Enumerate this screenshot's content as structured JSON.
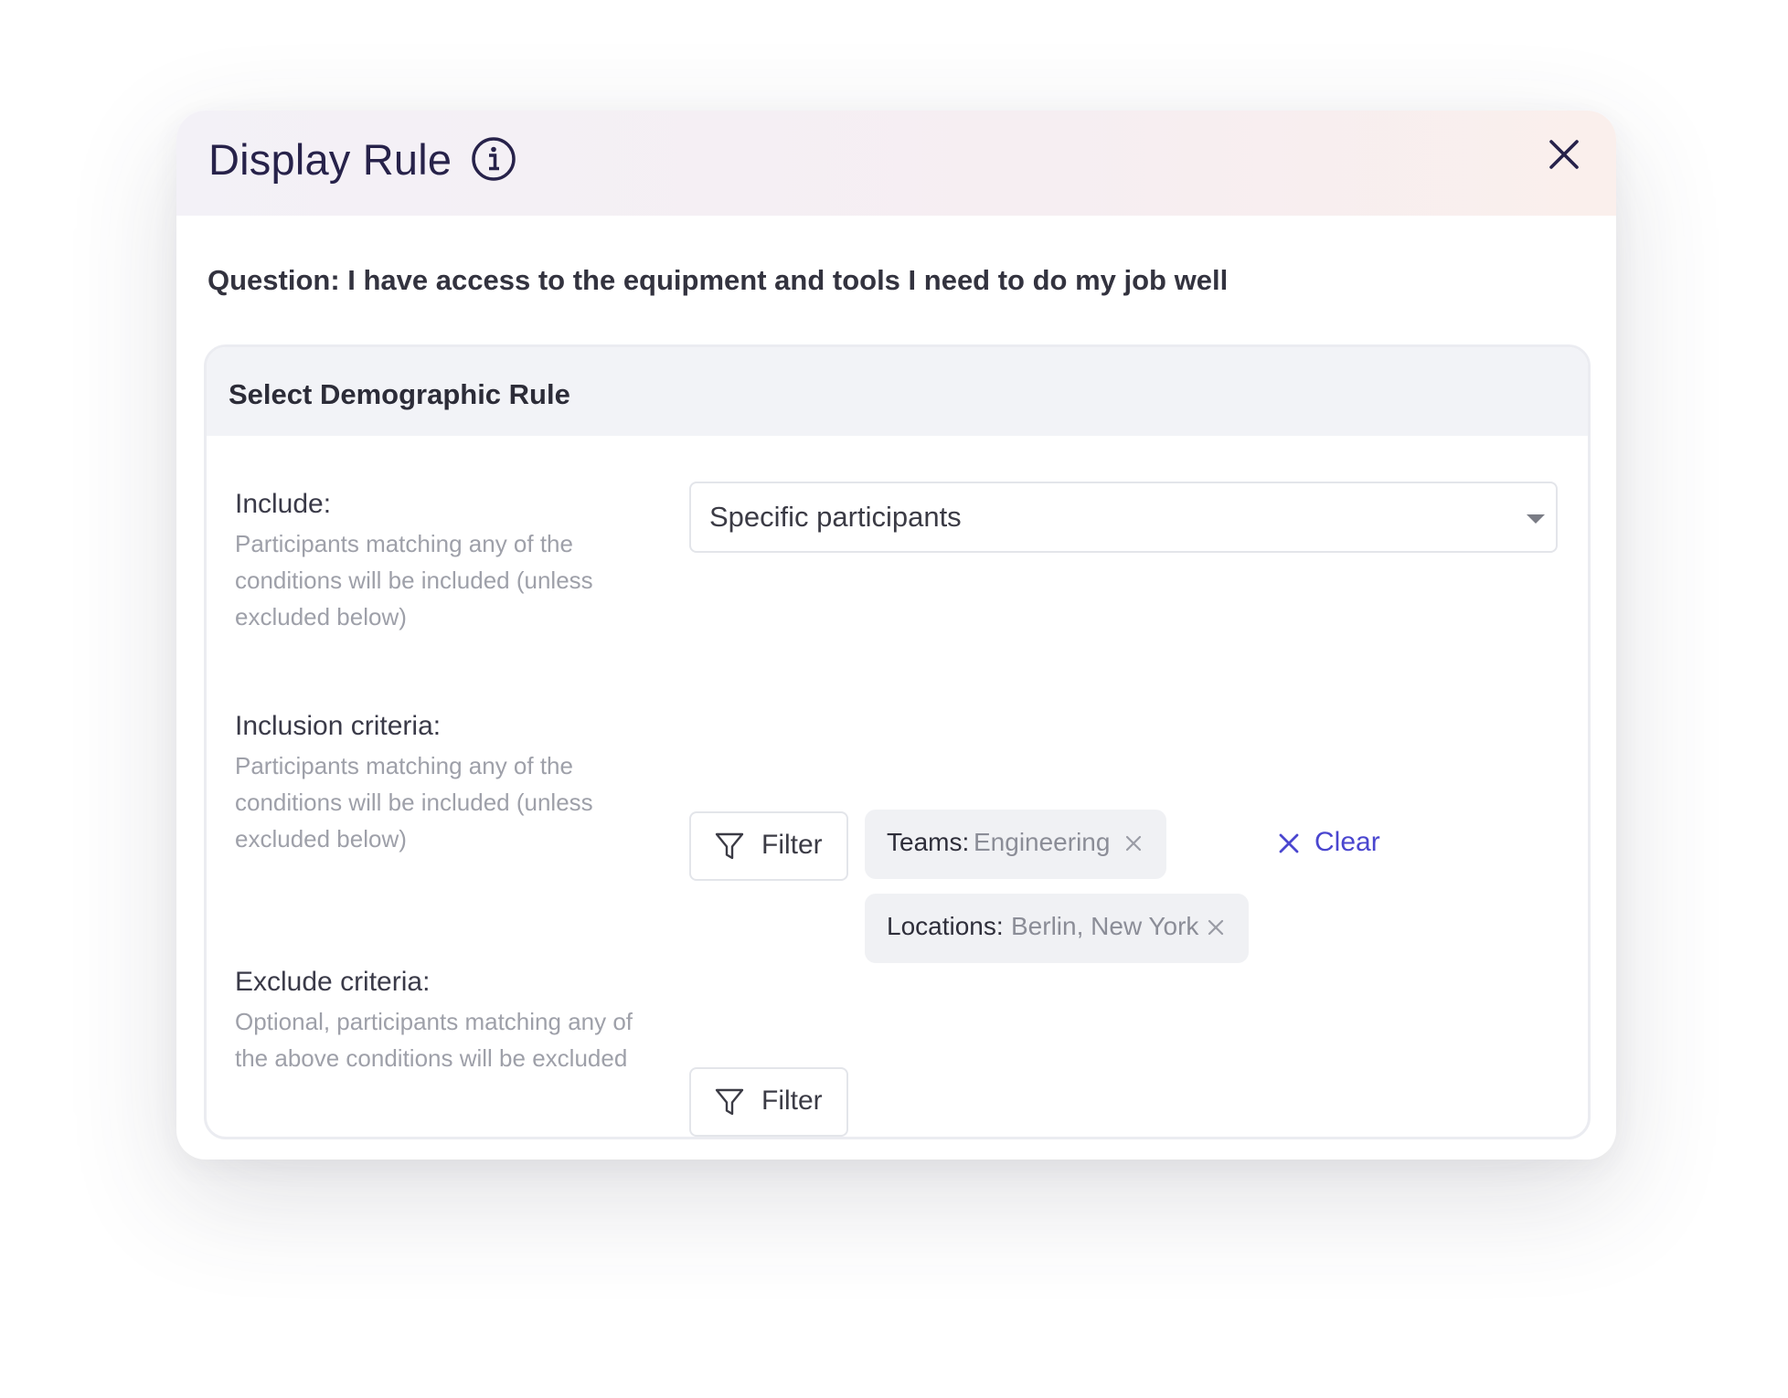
{
  "modal": {
    "title": "Display Rule",
    "question": "Question: I have access to the equipment and tools I need to do my job well"
  },
  "rule_card": {
    "title": "Select Demographic Rule",
    "include": {
      "label": "Include:",
      "help": "Participants matching any of the conditions will be included (unless excluded below)",
      "selected": "Specific participants"
    },
    "inclusion": {
      "label": "Inclusion criteria:",
      "help": "Participants matching any of the conditions will be included (unless excluded below)",
      "filter_label": "Filter",
      "chips": [
        {
          "key": "Teams:",
          "value": "Engineering"
        },
        {
          "key": "Locations:",
          "value": "Berlin, New York"
        }
      ],
      "clear_label": "Clear"
    },
    "exclude": {
      "label": "Exclude criteria:",
      "help": "Optional, participants matching any of the above conditions will be excluded",
      "filter_label": "Filter"
    }
  },
  "icons": {
    "info": "info-icon",
    "close": "close-icon",
    "filter": "funnel-icon",
    "remove": "x-icon"
  },
  "colors": {
    "accent": "#4a46cf",
    "title": "#27224a",
    "muted_text": "#9ea0a9",
    "chip_bg": "#f0f1f4"
  }
}
